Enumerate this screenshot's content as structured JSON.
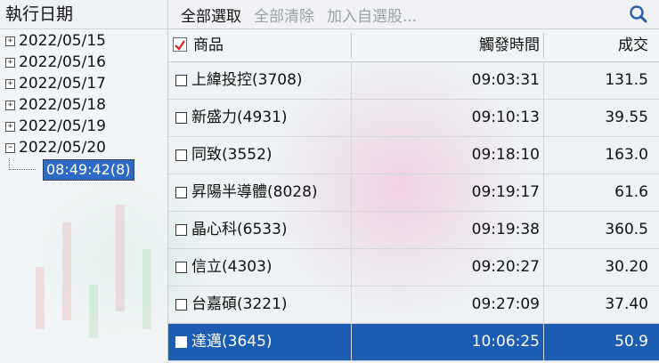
{
  "left_pane": {
    "header": "執行日期",
    "tree": [
      {
        "expander": "+",
        "label": "2022/05/15"
      },
      {
        "expander": "+",
        "label": "2022/05/16"
      },
      {
        "expander": "+",
        "label": "2022/05/17"
      },
      {
        "expander": "+",
        "label": "2022/05/18"
      },
      {
        "expander": "+",
        "label": "2022/05/19"
      },
      {
        "expander": "−",
        "label": "2022/05/20"
      }
    ],
    "selected_child": "08:49:42(8)"
  },
  "toolbar": {
    "select_all": "全部選取",
    "clear_all": "全部清除",
    "add_watchlist": "加入自選股...",
    "search_icon": "magnifier-icon"
  },
  "grid": {
    "columns": {
      "name": "商品",
      "trigger_time": "觸發時間",
      "price": "成交"
    },
    "rows": [
      {
        "name": "上緯投控(3708)",
        "time": "09:03:31",
        "price": "131.5"
      },
      {
        "name": "新盛力(4931)",
        "time": "09:10:13",
        "price": "39.55"
      },
      {
        "name": "同致(3552)",
        "time": "09:18:10",
        "price": "163.0"
      },
      {
        "name": "昇陽半導體(8028)",
        "time": "09:19:17",
        "price": "61.6"
      },
      {
        "name": "晶心科(6533)",
        "time": "09:19:38",
        "price": "360.5"
      },
      {
        "name": "信立(4303)",
        "time": "09:20:27",
        "price": "30.20"
      },
      {
        "name": "台嘉碩(3221)",
        "time": "09:27:09",
        "price": "37.40"
      },
      {
        "name": "達邁(3645)",
        "time": "10:06:25",
        "price": "50.9"
      }
    ],
    "selected_row_index": 7
  },
  "colors": {
    "selection": "#1c5cb3",
    "tree_selection": "#2f6bc6",
    "check_mark": "#d22"
  }
}
